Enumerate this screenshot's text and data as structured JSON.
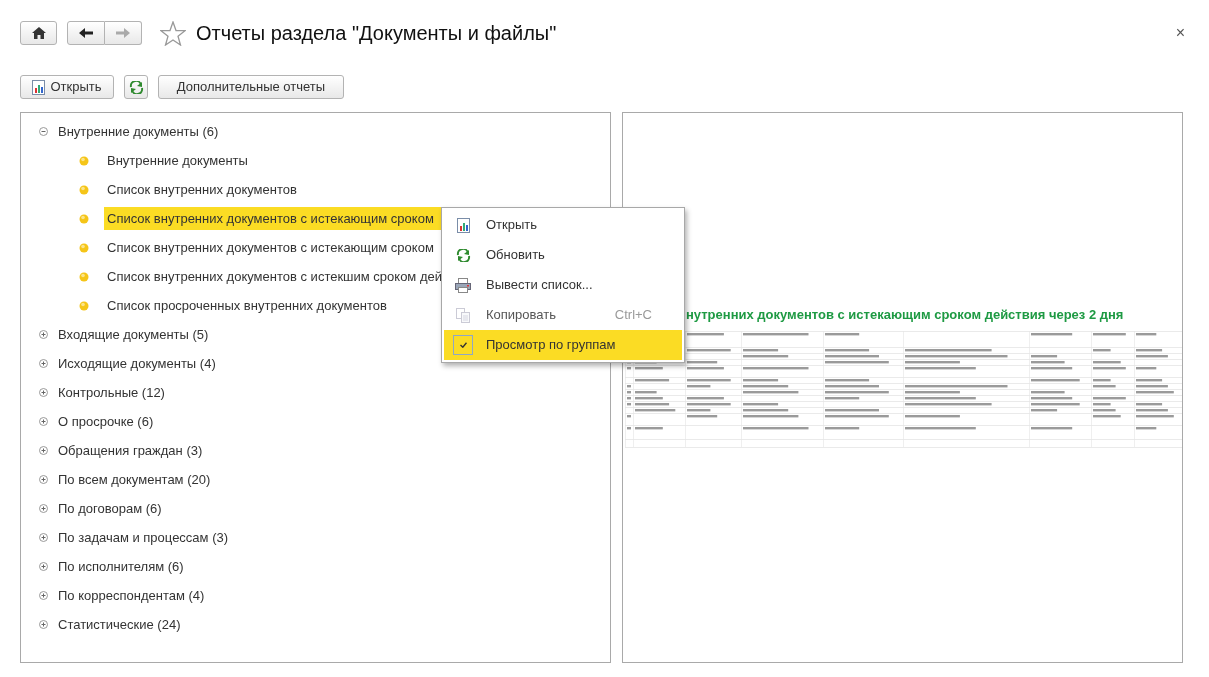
{
  "window": {
    "title": "Отчеты раздела \"Документы и файлы\"",
    "close": "×"
  },
  "nav": {
    "back_disabled": false,
    "forward_disabled": true,
    "favorite": false
  },
  "toolbar": [
    {
      "kind": "report",
      "label": "Открыть"
    },
    {
      "kind": "refresh"
    },
    {
      "kind": "text",
      "label": "Дополнительные отчеты"
    }
  ],
  "tree": [
    {
      "label": "Внутренние документы (6)",
      "expanded": true,
      "selected": false,
      "children": [
        {
          "label": "Внутренние документы",
          "selected": false
        },
        {
          "label": "Список внутренних документов",
          "selected": false
        },
        {
          "label": "Список внутренних документов с истекающим сроком",
          "selected": true
        },
        {
          "label": "Список внутренних документов с истекающим сроком",
          "selected": false
        },
        {
          "label": "Список внутренних документов с истекшим сроком дей",
          "selected": false
        },
        {
          "label": "Список просроченных внутренних документов",
          "selected": false
        }
      ]
    },
    {
      "label": "Входящие документы (5)",
      "expanded": false,
      "selected": false
    },
    {
      "label": "Исходящие документы (4)",
      "expanded": false,
      "selected": false
    },
    {
      "label": "Контрольные (12)",
      "expanded": false,
      "selected": false
    },
    {
      "label": "О просрочке (6)",
      "expanded": false,
      "selected": false
    },
    {
      "label": "Обращения граждан (3)",
      "expanded": false,
      "selected": false
    },
    {
      "label": "По всем документам (20)",
      "expanded": false,
      "selected": false
    },
    {
      "label": "По договорам (6)",
      "expanded": false,
      "selected": false
    },
    {
      "label": "По задачам и процессам (3)",
      "expanded": false,
      "selected": false
    },
    {
      "label": "По исполнителям (6)",
      "expanded": false,
      "selected": false
    },
    {
      "label": "По корреспондентам (4)",
      "expanded": false,
      "selected": false
    },
    {
      "label": "Статистические (24)",
      "expanded": false,
      "selected": false
    }
  ],
  "context_menu": {
    "items": [
      {
        "kind": "report",
        "label": "Открыть",
        "disabled": false,
        "selected": false
      },
      {
        "kind": "refresh",
        "label": "Обновить",
        "disabled": false,
        "selected": false
      },
      {
        "kind": "print",
        "label": "Вывести список...",
        "disabled": false,
        "selected": false
      },
      {
        "kind": "copy",
        "label": "Копировать",
        "shortcut": "Ctrl+C",
        "disabled": true,
        "selected": false
      },
      {
        "kind": "toggle",
        "label": "Просмотр по группам",
        "disabled": false,
        "checked": true,
        "selected": true
      }
    ]
  },
  "preview": {
    "title": "нутренних документов с истекающим сроком действия через 2 дня"
  }
}
